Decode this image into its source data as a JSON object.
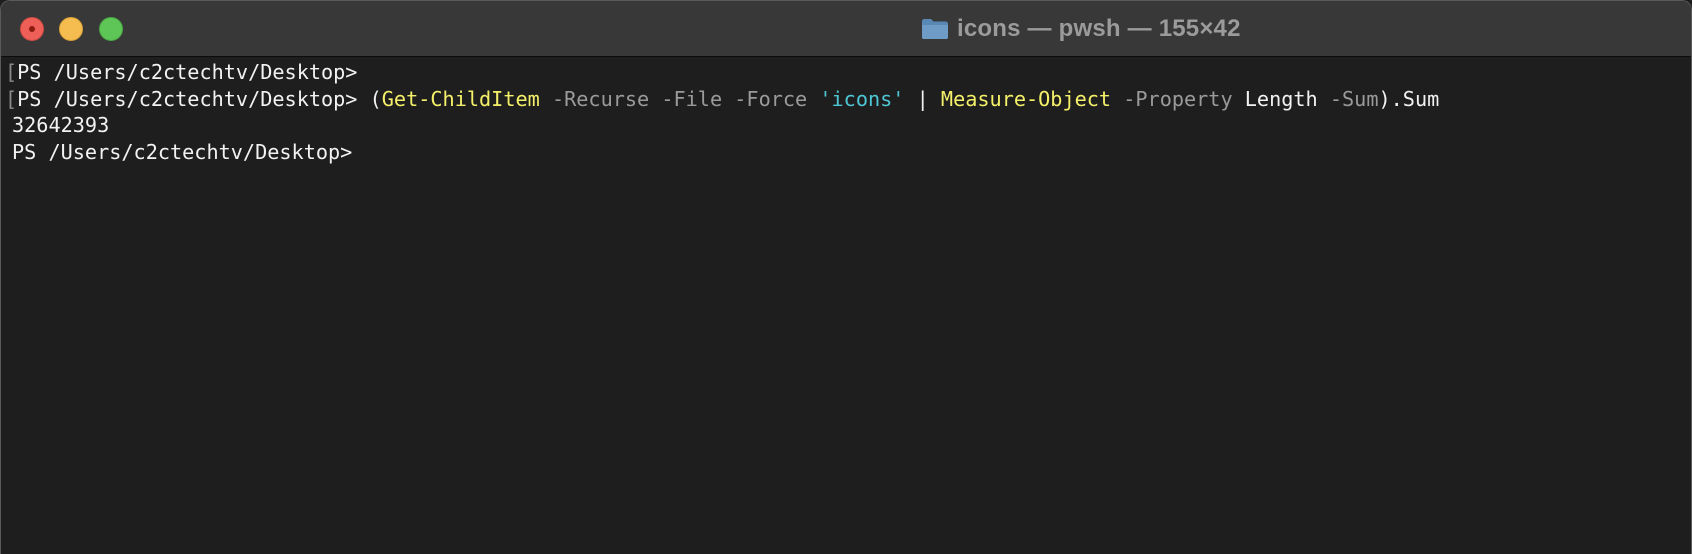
{
  "window": {
    "title": "icons — pwsh — 155×42"
  },
  "terminal": {
    "prompt": "PS /Users/c2ctechtv/Desktop>",
    "mark_char": "[",
    "lines": [
      {
        "prompt": "PS /Users/c2ctechtv/Desktop>",
        "marked": true
      },
      {
        "prompt": "PS /Users/c2ctechtv/Desktop>",
        "marked": true,
        "tokens": [
          {
            "text": "(",
            "kind": "plain"
          },
          {
            "text": "Get-ChildItem",
            "kind": "cmd"
          },
          {
            "text": "-Recurse",
            "kind": "param"
          },
          {
            "text": "-File",
            "kind": "param"
          },
          {
            "text": "-Force",
            "kind": "param"
          },
          {
            "text": "'icons'",
            "kind": "str"
          },
          {
            "text": "|",
            "kind": "plain"
          },
          {
            "text": "Measure-Object",
            "kind": "cmd"
          },
          {
            "text": "-Property",
            "kind": "param"
          },
          {
            "text": "Length",
            "kind": "plain"
          },
          {
            "text": "-Sum",
            "kind": "param"
          },
          {
            "text": ").Sum",
            "kind": "plain"
          }
        ]
      },
      {
        "output": "32642393"
      },
      {
        "prompt": "PS /Users/c2ctechtv/Desktop>",
        "marked": false
      }
    ]
  },
  "colors": {
    "background": "#1e1e1e",
    "titlebar": "#383838",
    "cmdlet": "#f4f06a",
    "parameter": "#9a9a9a",
    "string": "#4ec7d4",
    "text": "#f2f2f2"
  },
  "icons": {
    "title": "folder-icon",
    "close": "close-icon",
    "minimize": "minimize-icon",
    "zoom": "zoom-icon"
  }
}
